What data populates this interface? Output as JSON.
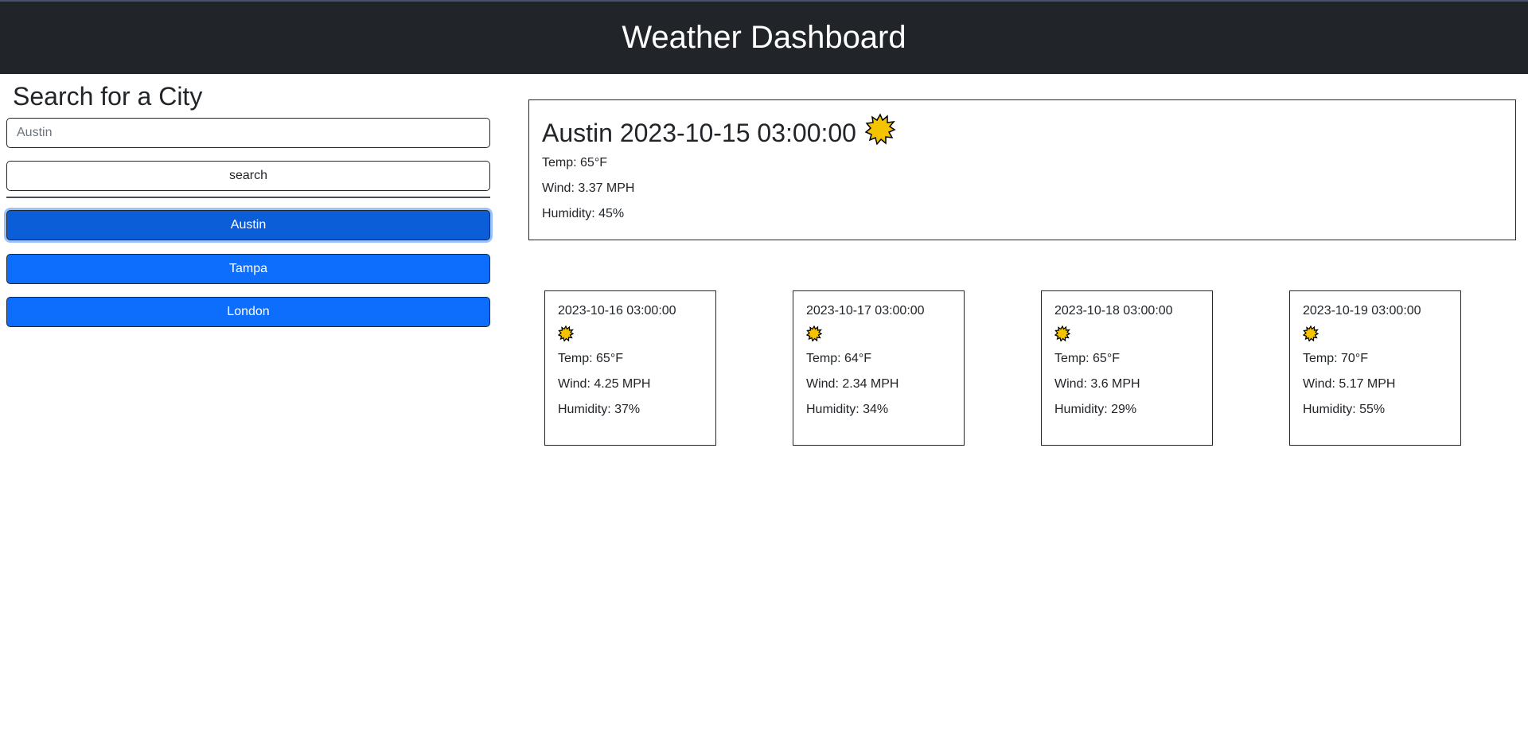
{
  "header": {
    "title": "Weather Dashboard"
  },
  "sidebar": {
    "heading": "Search for a City",
    "search": {
      "value": "Austin",
      "placeholder": "Austin"
    },
    "search_button_label": "search",
    "history": [
      {
        "label": "Austin",
        "active": true
      },
      {
        "label": "Tampa",
        "active": false
      },
      {
        "label": "London",
        "active": false
      }
    ]
  },
  "current": {
    "title": "Austin 2023-10-15 03:00:00",
    "icon": "sun-icon",
    "temp": "Temp: 65°F",
    "wind": "Wind: 3.37 MPH",
    "humidity": "Humidity: 45%"
  },
  "forecast": [
    {
      "date": "2023-10-16 03:00:00",
      "icon": "sun-icon",
      "temp": "Temp: 65°F",
      "wind": "Wind: 4.25 MPH",
      "humidity": "Humidity: 37%"
    },
    {
      "date": "2023-10-17 03:00:00",
      "icon": "sun-icon",
      "temp": "Temp: 64°F",
      "wind": "Wind: 2.34 MPH",
      "humidity": "Humidity: 34%"
    },
    {
      "date": "2023-10-18 03:00:00",
      "icon": "sun-icon",
      "temp": "Temp: 65°F",
      "wind": "Wind: 3.6 MPH",
      "humidity": "Humidity: 29%"
    },
    {
      "date": "2023-10-19 03:00:00",
      "icon": "sun-icon",
      "temp": "Temp: 70°F",
      "wind": "Wind: 5.17 MPH",
      "humidity": "Humidity: 55%"
    }
  ],
  "colors": {
    "header_bg": "#212529",
    "primary_button": "#0d6efd",
    "active_button": "#0b5ed7",
    "sun_fill": "#f5c400"
  }
}
